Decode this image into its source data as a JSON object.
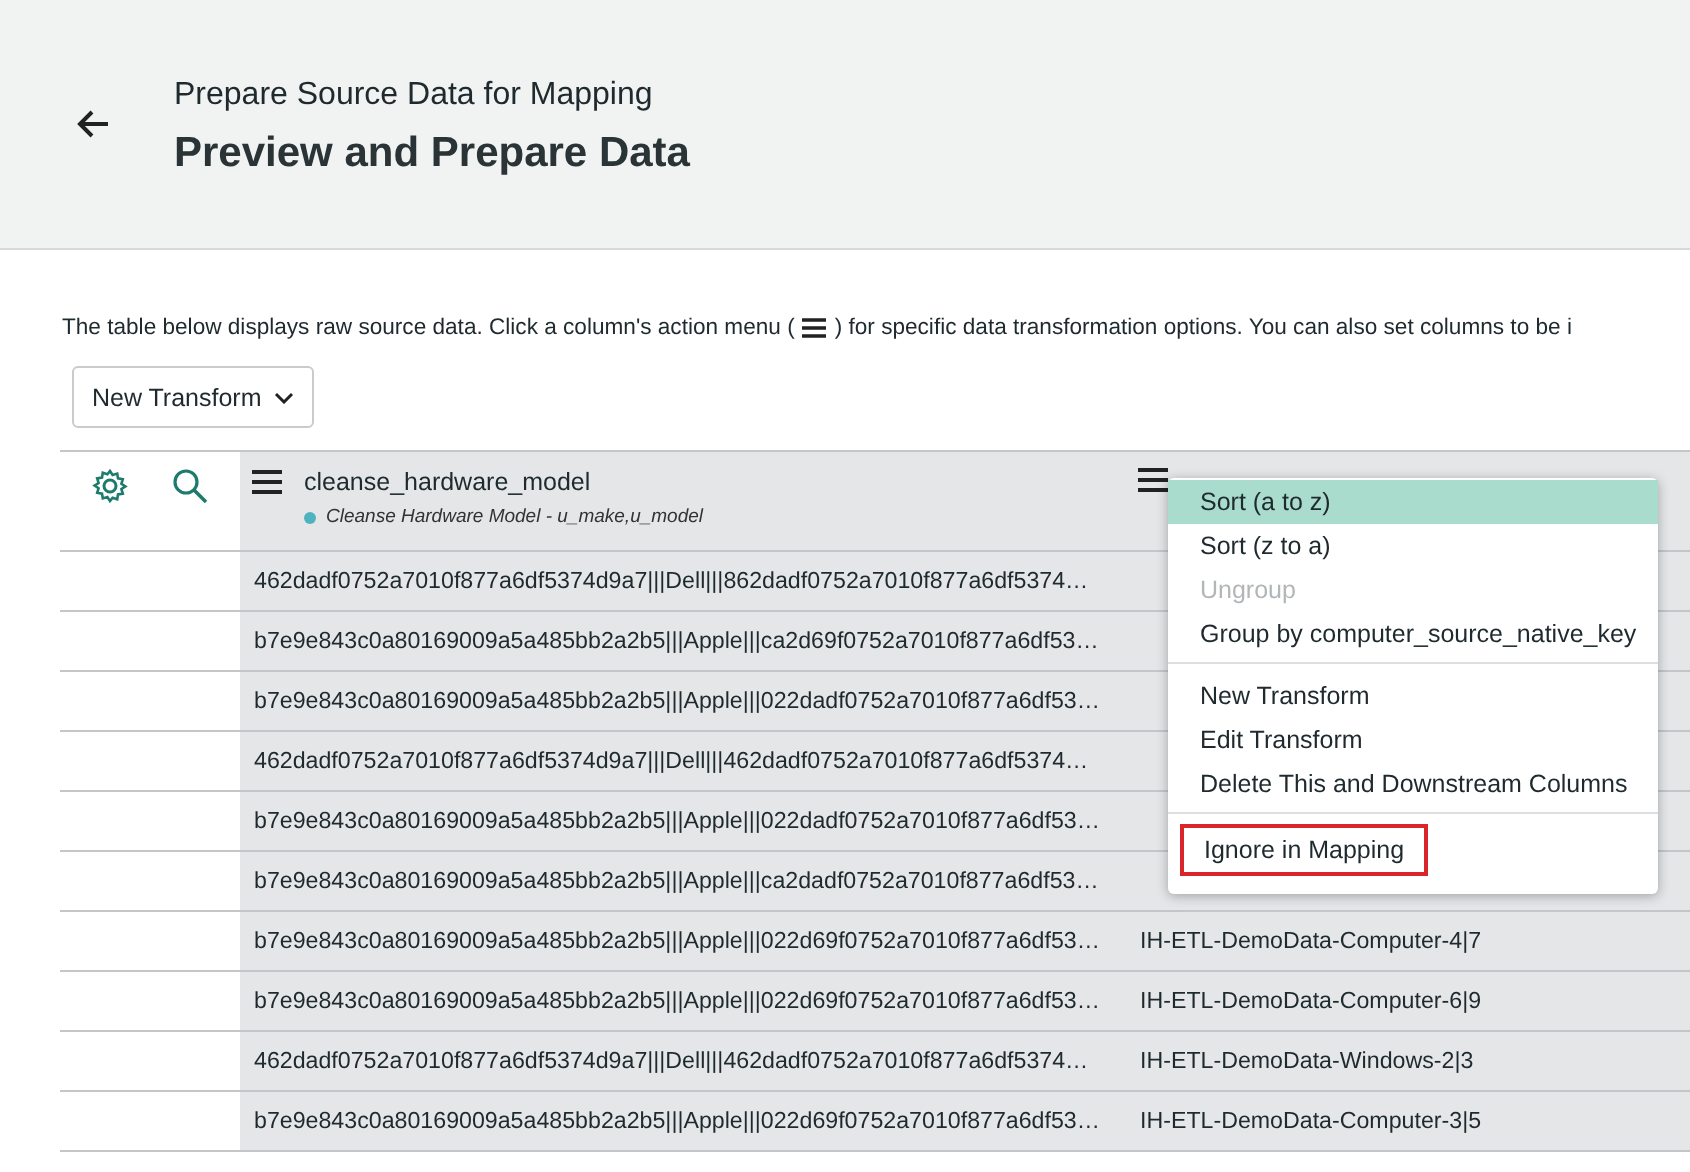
{
  "header": {
    "subtitle": "Prepare Source Data for Mapping",
    "title": "Preview and Prepare Data"
  },
  "description": {
    "before": "The table below displays raw source data. Click a column's action menu (",
    "after": ") for specific data transformation options. You can also set columns to be i"
  },
  "transform_button": {
    "label": "New Transform"
  },
  "table": {
    "columns": [
      {
        "name": "cleanse_hardware_model",
        "transform": "Cleanse Hardware Model - u_make,u_model",
        "color": "#4fb3bf"
      },
      {}
    ],
    "rows": [
      {
        "cells": [
          "462dadf0752a7010f877a6df5374d9a7|||Dell|||862dadf0752a7010f877a6df5374…",
          null
        ]
      },
      {
        "cells": [
          "b7e9e843c0a80169009a5a485bb2a2b5|||Apple|||ca2d69f0752a7010f877a6df53…",
          null
        ]
      },
      {
        "cells": [
          "b7e9e843c0a80169009a5a485bb2a2b5|||Apple|||022dadf0752a7010f877a6df53…",
          null
        ]
      },
      {
        "cells": [
          "462dadf0752a7010f877a6df5374d9a7|||Dell|||462dadf0752a7010f877a6df5374…",
          null
        ]
      },
      {
        "cells": [
          "b7e9e843c0a80169009a5a485bb2a2b5|||Apple|||022dadf0752a7010f877a6df53…",
          null
        ]
      },
      {
        "cells": [
          "b7e9e843c0a80169009a5a485bb2a2b5|||Apple|||ca2dadf0752a7010f877a6df53…",
          null
        ]
      },
      {
        "cells": [
          "b7e9e843c0a80169009a5a485bb2a2b5|||Apple|||022d69f0752a7010f877a6df53…",
          "IH-ETL-DemoData-Computer-4|7"
        ]
      },
      {
        "cells": [
          "b7e9e843c0a80169009a5a485bb2a2b5|||Apple|||022d69f0752a7010f877a6df53…",
          "IH-ETL-DemoData-Computer-6|9"
        ]
      },
      {
        "cells": [
          "462dadf0752a7010f877a6df5374d9a7|||Dell|||462dadf0752a7010f877a6df5374…",
          "IH-ETL-DemoData-Windows-2|3"
        ]
      },
      {
        "cells": [
          "b7e9e843c0a80169009a5a485bb2a2b5|||Apple|||022d69f0752a7010f877a6df53…",
          "IH-ETL-DemoData-Computer-3|5"
        ]
      }
    ]
  },
  "column_menu": {
    "groups": [
      [
        {
          "label": "Sort (a to z)",
          "selected": true,
          "disabled": false,
          "outlined": false
        },
        {
          "label": "Sort (z to a)",
          "selected": false,
          "disabled": false,
          "outlined": false
        },
        {
          "label": "Ungroup",
          "selected": false,
          "disabled": true,
          "outlined": false
        },
        {
          "label": "Group by computer_source_native_key",
          "selected": false,
          "disabled": false,
          "outlined": false
        }
      ],
      [
        {
          "label": "New Transform",
          "selected": false,
          "disabled": false,
          "outlined": false
        },
        {
          "label": "Edit Transform",
          "selected": false,
          "disabled": false,
          "outlined": false
        },
        {
          "label": "Delete This and Downstream Columns",
          "selected": false,
          "disabled": false,
          "outlined": false
        }
      ],
      [
        {
          "label": "Ignore in Mapping",
          "selected": false,
          "disabled": false,
          "outlined": true
        }
      ]
    ]
  }
}
